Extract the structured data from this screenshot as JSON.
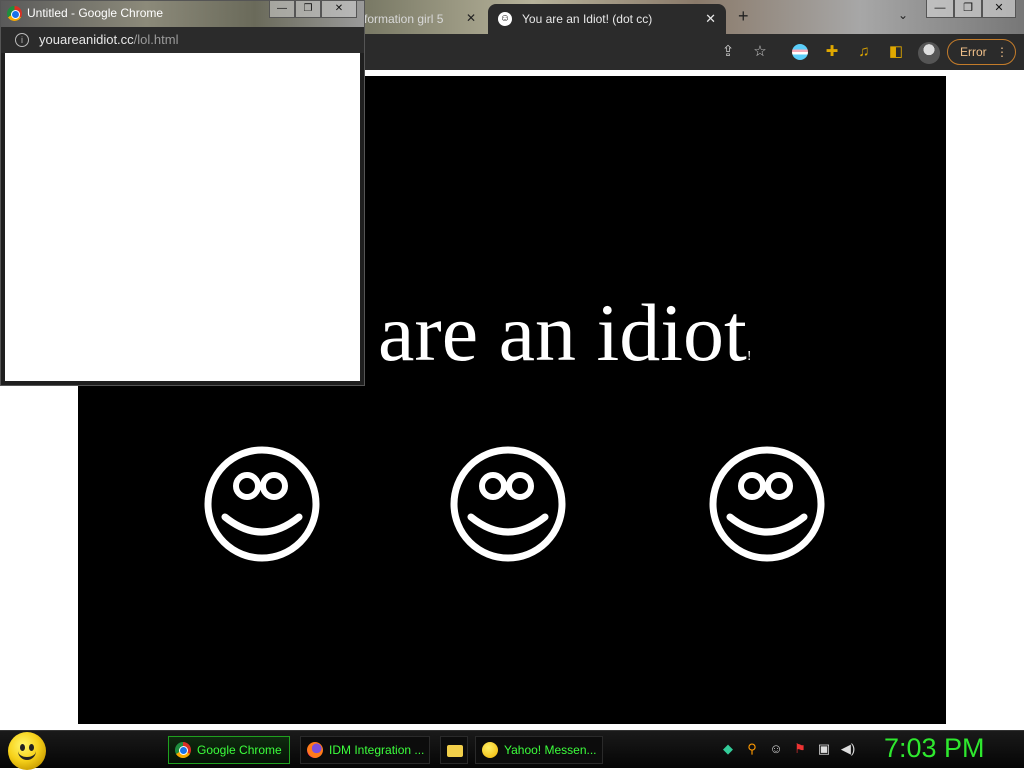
{
  "browser": {
    "tabs": [
      {
        "label": "formation girl 5",
        "active": false
      },
      {
        "label": "You are an Idiot! (dot cc)",
        "active": true,
        "favicon": "smiley-icon"
      }
    ],
    "new_tab": "+",
    "tab_search": "⌄",
    "window_controls": {
      "minimize": "—",
      "maximize": "❐",
      "close": "✕"
    },
    "toolbar": {
      "icons": [
        "share-icon",
        "star-icon",
        "extension-flag-icon",
        "puzzle-icon",
        "media-icon",
        "side-panel-icon",
        "profile-avatar"
      ],
      "error_label": "Error"
    }
  },
  "page": {
    "headline": "are an idiot",
    "headline_tail": "!",
    "smileys": 3,
    "background_color": "#000000",
    "text_color": "#ffffff"
  },
  "popup": {
    "title": "Untitled - Google Chrome",
    "url_host": "youareanidiot.cc",
    "url_path": "/lol.html",
    "controls": {
      "minimize": "—",
      "maximize": "❐",
      "close": "✕"
    }
  },
  "taskbar": {
    "start_icon": "yahoo-smiley-icon",
    "tasks": [
      {
        "label": "Google Chrome",
        "icon": "chrome-icon"
      },
      {
        "label": "IDM Integration ...",
        "icon": "firefox-icon"
      },
      {
        "label": "",
        "icon": "folder-icon"
      },
      {
        "label": "Yahoo! Messen...",
        "icon": "yahoo-icon"
      }
    ],
    "tray_icons": [
      "network-icon",
      "search-icon",
      "messenger-icon",
      "flag-icon",
      "display-icon",
      "volume-icon"
    ],
    "clock": "7:03 PM",
    "accent_color": "#2ee82e"
  }
}
